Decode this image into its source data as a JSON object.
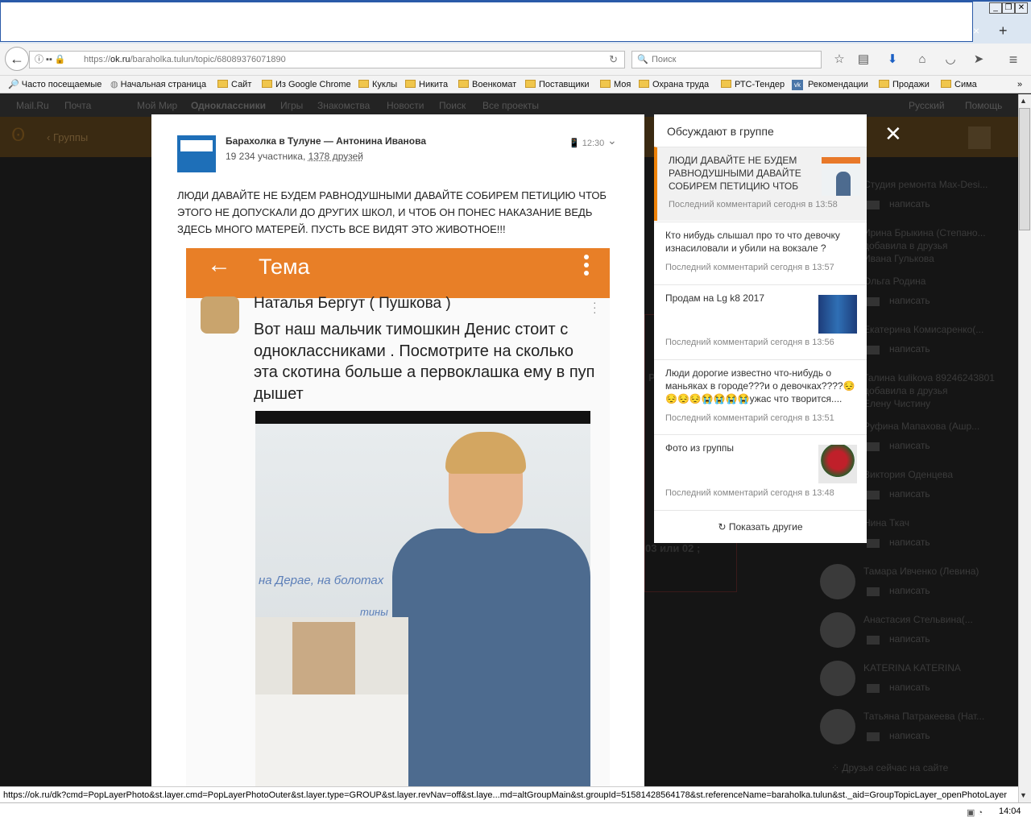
{
  "browser": {
    "url_prefix": "https://",
    "url_host": "ok.ru",
    "url_path": "/baraholka.tulun/topic/68089376071890",
    "search_placeholder": "Поиск",
    "new_tab": "+",
    "tab_close": "×"
  },
  "bookmarks": [
    "Часто посещаемые",
    "Начальная страница",
    "Сайт",
    "Из Google Chrome",
    "Куклы",
    "Никита",
    "Военкомат",
    "Поставщики",
    "Моя",
    "Охрана труда",
    "РТС-Тендер",
    "Рекомендации",
    "Продажи",
    "Сима"
  ],
  "bookmarks_more": "»",
  "ok_top": [
    "Mail.Ru",
    "Почта",
    "Мой Мир",
    "Одноклассники",
    "Игры",
    "Знакомства",
    "Новости",
    "Поиск",
    "Все проекты"
  ],
  "ok_top_right": [
    "Русский",
    "Помощь"
  ],
  "ok_header": {
    "back": "Группы"
  },
  "post": {
    "group_title": "Барахолка в Тулуне — Антонина Иванова",
    "members": "19 234 участника,",
    "friends": "1378 друзей",
    "time": "12:30",
    "text": "ЛЮДИ ДАВАЙТЕ НЕ БУДЕМ РАВНОДУШНЫМИ ДАВАЙТЕ СОБИРЕМ ПЕТИЦИЮ ЧТОБ ЭТОГО НЕ ДОПУСКАЛИ ДО ДРУГИХ ШКОЛ, И ЧТОБ ОН ПОНЕС НАКАЗАНИЕ ВЕДЬ ЗДЕСЬ МНОГО МАТЕРЕЙ. ПУСТЬ ВСЕ ВИДЯТ ЭТО ЖИВОТНОЕ!!!"
  },
  "screenshot": {
    "app_title": "Тема",
    "author": "Наталья Бергут ( Пушкова )",
    "comment": "Вот наш мальчик тимошкин Денис стоит с одноклассниками . Посмотрите на сколько эта скотина больше а первоклашка ему в пуп дышет",
    "board_text": "на Дерае, на болотах",
    "board_text2": "тины"
  },
  "side": {
    "header": "Обсуждают в группе",
    "items": [
      {
        "title": "ЛЮДИ ДАВАЙТЕ НЕ БУДЕМ РАВНОДУШНЫМИ ДАВАЙТЕ СОБИРЕМ ПЕТИЦИЮ ЧТОБ",
        "comment": "Последний комментарий сегодня в 13:58"
      },
      {
        "title": "Кто нибудь слышал про то что девочку изнасиловали и убили на вокзале ?",
        "comment": "Последний комментарий сегодня в 13:57"
      },
      {
        "title": "Продам на Lg k8 2017",
        "comment": "Последний комментарий сегодня в 13:56"
      },
      {
        "title": "Люди дорогие известно что-нибудь о маньяках в городе???и о девочках????😔😔😔😔😭😭😭😭ужас что творится....",
        "comment": "Последний комментарий сегодня в 13:51"
      },
      {
        "title": "Фото из группы",
        "comment": "Последний комментарий сегодня в 13:48"
      }
    ],
    "show_more": "Показать другие"
  },
  "right_list": {
    "names": [
      "Студия ремонта Max-Desi...",
      "Ирина Брыкина (Степано...",
      "Ольга Родина",
      "Екатерина Комисаренко(...",
      "Галина kulikova 89246243801",
      "Руфина Мапахова (Ашр...",
      "Виктория Оденцева",
      "Нина Ткач",
      "Тамара Ивченко (Левина)",
      "Анастасия Стельвина(...",
      "KATERINA KATERINA",
      "Татьяна Патракеева (Нат..."
    ],
    "write": "написать",
    "added_1": "добавила в друзья",
    "added_1_name": "Ивана Гулькова",
    "added_2": "добавила в друзья",
    "added_2_name": "Елену Чистину",
    "online": "Друзья сейчас на сайте",
    "bg_fragment_1": "03  или 02 ;",
    "bg_fragment_2": "Р"
  },
  "status_url": "https://ok.ru/dk?cmd=PopLayerPhoto&st.layer.cmd=PopLayerPhotoOuter&st.layer.type=GROUP&st.layer.revNav=off&st.laye...md=altGroupMain&st.groupId=51581428564178&st.referenceName=baraholka.tulun&st._aid=GroupTopicLayer_openPhotoLayer",
  "clock": "14:04",
  "colors": {
    "accent": "#ee8208",
    "app_bar": "#e87f27"
  }
}
